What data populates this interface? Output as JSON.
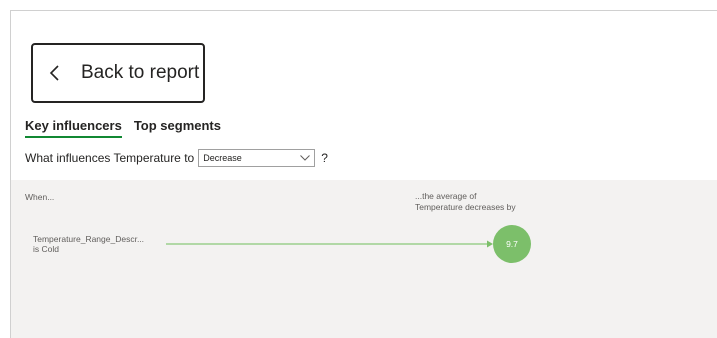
{
  "back_button": {
    "label": "Back to report"
  },
  "tabs": [
    {
      "label": "Key influencers",
      "active": true
    },
    {
      "label": "Top segments",
      "active": false
    }
  ],
  "question": {
    "text": "What influences Temperature to",
    "selected": "Decrease",
    "suffix": "?"
  },
  "panel": {
    "when_header": "When...",
    "avg_header_line1": "...the average of",
    "avg_header_line2": "Temperature decreases by",
    "influencers": [
      {
        "label_line1": "Temperature_Range_Descr...",
        "label_line2": "is Cold",
        "value": "9.7"
      }
    ]
  },
  "colors": {
    "accent": "#118833",
    "bubble": "#7cbf6a",
    "connector": "#9bd08d"
  }
}
